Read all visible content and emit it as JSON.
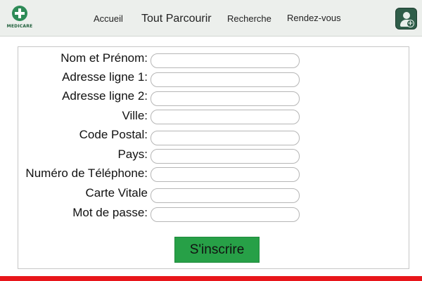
{
  "brand": {
    "logo_text": "MEDICARE",
    "accent": "#2e8b57"
  },
  "nav": {
    "items": [
      {
        "label": "Accueil"
      },
      {
        "label": "Tout Parcourir"
      },
      {
        "label": "Recherche"
      },
      {
        "label": "Rendez-vous"
      }
    ],
    "account_icon": "add-user-icon"
  },
  "form": {
    "fields": [
      {
        "label": "Nom et Prénom:",
        "value": ""
      },
      {
        "label": "Adresse ligne 1:",
        "value": ""
      },
      {
        "label": "Adresse ligne 2:",
        "value": ""
      },
      {
        "label": "Ville:",
        "value": ""
      },
      {
        "label": "Code Postal:",
        "value": ""
      },
      {
        "label": "Pays:",
        "value": ""
      },
      {
        "label": "Numéro de Téléphone:",
        "value": ""
      },
      {
        "label": "Carte Vitale",
        "value": ""
      },
      {
        "label": "Mot de passe:",
        "value": ""
      }
    ],
    "submit_label": "S'inscrire",
    "submit_color": "#27a047"
  },
  "footer": {
    "bar_color": "#e8161b"
  }
}
